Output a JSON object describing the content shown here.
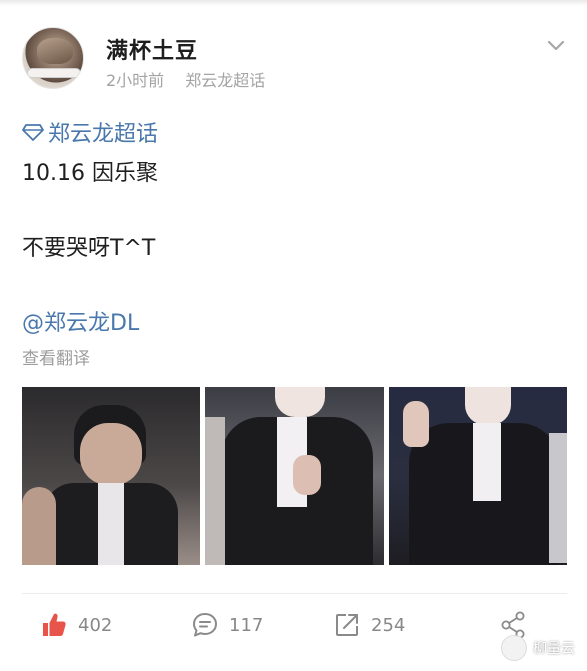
{
  "post": {
    "username": "满杯土豆",
    "time": "2小时前",
    "source": "郑云龙超话",
    "topic": "郑云龙超话",
    "lines": [
      "10.16 因乐聚",
      "不要哭呀T^T"
    ],
    "mention": "@郑云龙DL",
    "translate": "查看翻译"
  },
  "actions": {
    "likes": "402",
    "comments": "117",
    "reposts": "254"
  },
  "watermark": "柳量云",
  "icons": [
    "chevron-down-icon",
    "diamond-icon",
    "like-icon",
    "comment-icon",
    "repost-icon",
    "share-icon"
  ],
  "colors": {
    "link": "#4a78ad",
    "like": "#e8534a",
    "muted": "#a4a4a4"
  }
}
